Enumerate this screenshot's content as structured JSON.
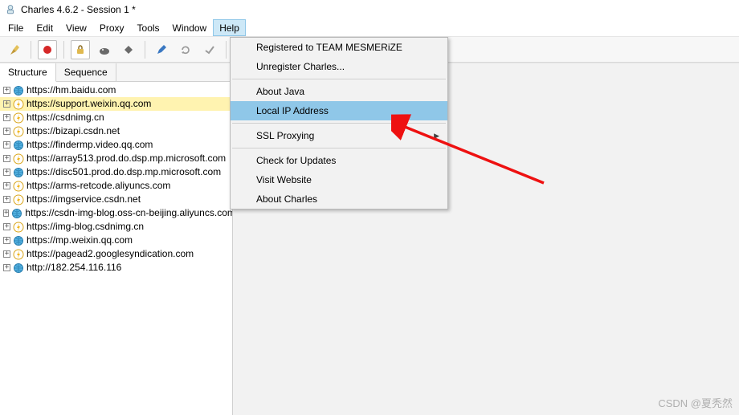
{
  "window": {
    "title": "Charles 4.6.2 - Session 1 *"
  },
  "menubar": [
    "File",
    "Edit",
    "View",
    "Proxy",
    "Tools",
    "Window",
    "Help"
  ],
  "menubar_open_index": 6,
  "toolbar": {
    "buttons": [
      "broom",
      "record",
      "lock",
      "turtle",
      "turtle2",
      "pencil",
      "settings",
      "checkmark",
      "tool",
      "wrench"
    ]
  },
  "tabs": [
    {
      "label": "Structure",
      "active": true
    },
    {
      "label": "Sequence",
      "active": false
    }
  ],
  "tree": [
    {
      "icon": "globe",
      "label": "https://hm.baidu.com",
      "hl": false
    },
    {
      "icon": "bolt",
      "label": "https://support.weixin.qq.com",
      "hl": true
    },
    {
      "icon": "bolt",
      "label": "https://csdnimg.cn",
      "hl": false
    },
    {
      "icon": "bolt",
      "label": "https://bizapi.csdn.net",
      "hl": false
    },
    {
      "icon": "globe",
      "label": "https://findermp.video.qq.com",
      "hl": false
    },
    {
      "icon": "bolt",
      "label": "https://array513.prod.do.dsp.mp.microsoft.com",
      "hl": false
    },
    {
      "icon": "globe",
      "label": "https://disc501.prod.do.dsp.mp.microsoft.com",
      "hl": false
    },
    {
      "icon": "bolt",
      "label": "https://arms-retcode.aliyuncs.com",
      "hl": false
    },
    {
      "icon": "bolt",
      "label": "https://imgservice.csdn.net",
      "hl": false
    },
    {
      "icon": "globe",
      "label": "https://csdn-img-blog.oss-cn-beijing.aliyuncs.com",
      "hl": false
    },
    {
      "icon": "bolt",
      "label": "https://img-blog.csdnimg.cn",
      "hl": false
    },
    {
      "icon": "globe",
      "label": "https://mp.weixin.qq.com",
      "hl": false
    },
    {
      "icon": "bolt",
      "label": "https://pagead2.googlesyndication.com",
      "hl": false
    },
    {
      "icon": "globe",
      "label": "http://182.254.116.116",
      "hl": false
    }
  ],
  "help_menu": [
    {
      "type": "item",
      "label": "Registered to TEAM MESMERiZE"
    },
    {
      "type": "item",
      "label": "Unregister Charles..."
    },
    {
      "type": "sep"
    },
    {
      "type": "item",
      "label": "About Java"
    },
    {
      "type": "item",
      "label": "Local IP Address",
      "highlight": true
    },
    {
      "type": "sep"
    },
    {
      "type": "item",
      "label": "SSL Proxying",
      "submenu": true
    },
    {
      "type": "sep"
    },
    {
      "type": "item",
      "label": "Check for Updates"
    },
    {
      "type": "item",
      "label": "Visit Website"
    },
    {
      "type": "item",
      "label": "About Charles"
    }
  ],
  "watermark": "CSDN @夏秃然"
}
